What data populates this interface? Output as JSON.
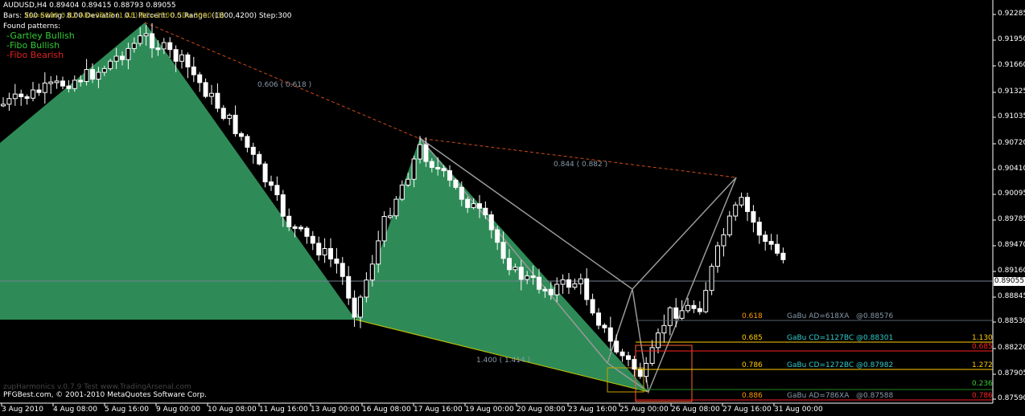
{
  "header": {
    "symbol_line": "AUDUSD,H4  0.89404 0.89415 0.88793 0.89055",
    "params_line": "Bars: 500   Swing: 8.00  Deviation: 0.1  Percent: 0.5  Range: (1800,4200)  Step:300",
    "overlap_line": "XA=6800 0.82 AB=3639 (1.48) BC=2500 CD=3000 (3)",
    "found_label": "Found patterns:",
    "patterns": [
      {
        "label": "-Gartley Bullish",
        "color": "#33cc33"
      },
      {
        "label": "-Fibo Bullish",
        "color": "#33cc33"
      },
      {
        "label": "-Fibo Bearish",
        "color": "#e02020"
      }
    ]
  },
  "footer": {
    "watermark": "zupHarmonics v.0.7.9 Test www.TradingArsenal.com",
    "copyright": "PFGBest.com, © 2001-2010 MetaQuotes Software Corp."
  },
  "price_axis": {
    "ticks": [
      "0.92285",
      "0.91950",
      "0.91660",
      "0.91325",
      "0.91035",
      "0.90720",
      "0.90410",
      "0.90095",
      "0.89785",
      "0.89470",
      "0.89160",
      "0.88845",
      "0.88530",
      "0.88220",
      "0.87905",
      "0.87590"
    ],
    "current_price": "0.89055"
  },
  "time_axis": {
    "ticks": [
      "3 Aug 2010",
      "4 Aug 08:00",
      "5 Aug 16:00",
      "9 Aug 00:00",
      "10 Aug 08:00",
      "11 Aug 16:00",
      "13 Aug 00:00",
      "16 Aug 08:00",
      "17 Aug 16:00",
      "19 Aug 00:00",
      "20 Aug 08:00",
      "23 Aug 16:00",
      "25 Aug 00:00",
      "26 Aug 08:00",
      "27 Aug 16:00",
      "31 Aug 00:00"
    ]
  },
  "ratio_labels": [
    {
      "text": "0.606 ( 0.618 )"
    },
    {
      "text": "0.844 ( 0.882 )"
    },
    {
      "text": "1.400 ( 1.414 )"
    }
  ],
  "fib_levels": [
    {
      "ratio": "0.618",
      "desc": "GaBu AD=618XA",
      "price": "@0.88576",
      "right": "",
      "ratio_color": "#ff9900",
      "desc_color": "#8899aa",
      "right_color": "#ffffff",
      "line_color": "#556070"
    },
    {
      "ratio": "0.685",
      "desc": "GaBu CD=1127BC",
      "price": "@0.88301",
      "right": "1.130",
      "ratio_color": "#ffcc00",
      "desc_color": "#33cccc",
      "right_color": "#ffcc00",
      "line_color": "#ffcc00"
    },
    {
      "ratio": "",
      "desc": "",
      "price": "",
      "right": "0.685",
      "ratio_color": "#ff2020",
      "desc_color": "#ff2020",
      "right_color": "#ff2020",
      "line_color": "#ff2020"
    },
    {
      "ratio": "0.786",
      "desc": "GaBu CD=1272BC",
      "price": "@0.87982",
      "right": "1.272",
      "ratio_color": "#ffcc00",
      "desc_color": "#33cccc",
      "right_color": "#ffcc00",
      "line_color": "#ffcc00"
    },
    {
      "ratio": "",
      "desc": "",
      "price": "",
      "right": "0.236",
      "ratio_color": "#33cc33",
      "desc_color": "#33cc33",
      "right_color": "#33cc33",
      "line_color": "#228822"
    },
    {
      "ratio": "0.886",
      "desc": "GaBu AD=786XA",
      "price": "@0.87588",
      "right": "0.786",
      "ratio_color": "#ff9900",
      "desc_color": "#8899aa",
      "right_color": "#ff2020",
      "line_color": "#ff2020"
    }
  ],
  "colors": {
    "background": "#000000",
    "bullish_fill": "#2e8b57",
    "candle_up": "#000000",
    "candle_down": "#ffffff",
    "pattern_lines": "#999999",
    "trend_line": "#cc4a1a",
    "price_line": "#708090"
  }
}
